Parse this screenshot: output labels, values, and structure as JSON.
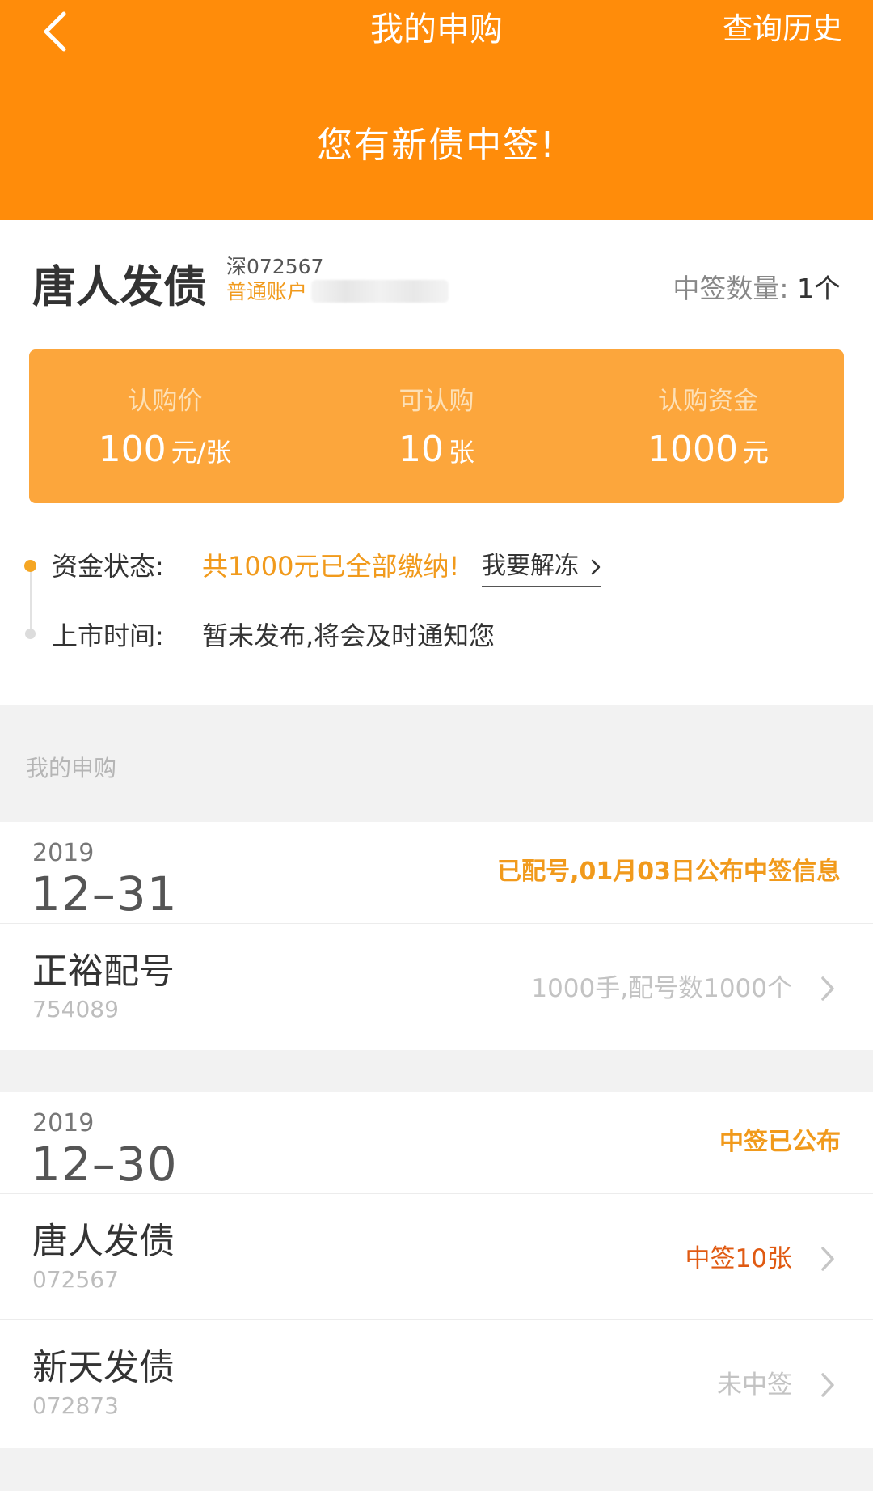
{
  "header": {
    "title": "我的申购",
    "history_label": "查询历史",
    "banner": "您有新债中签!"
  },
  "win_card": {
    "bond_name": "唐人发债",
    "bond_code": "深072567",
    "account_type": "普通账户",
    "win_count_label": "中签数量:",
    "win_count_value": "1个",
    "subscription": [
      {
        "label": "认购价",
        "value": "100",
        "unit": "元/张"
      },
      {
        "label": "可认购",
        "value": "10",
        "unit": "张"
      },
      {
        "label": "认购资金",
        "value": "1000",
        "unit": "元"
      }
    ],
    "fund_status_label": "资金状态:",
    "fund_status_value": "共1000元已全部缴纳!",
    "unfreeze_label": "我要解冻",
    "listing_time_label": "上市时间:",
    "listing_time_value": "暂未发布,将会及时通知您"
  },
  "section_title": "我的申购",
  "groups": [
    {
      "year": "2019",
      "month_day": "12–31",
      "status": "已配号,01月03日公布中签信息",
      "entries": [
        {
          "name": "正裕配号",
          "code": "754089",
          "detail": "1000手,配号数1000个"
        }
      ]
    },
    {
      "year": "2019",
      "month_day": "12–30",
      "status": "中签已公布",
      "entries": [
        {
          "name": "唐人发债",
          "code": "072567",
          "detail": "中签10张"
        },
        {
          "name": "新天发债",
          "code": "072873",
          "detail": "未中签"
        }
      ]
    }
  ],
  "colors": {
    "header_bg": "#ff8c0a",
    "card_bg": "#fca63c",
    "accent": "#f19a1c",
    "win_red": "#e05a12"
  },
  "icons": {
    "back": "chevron-left-icon",
    "row_arrow": "chevron-right-icon"
  }
}
